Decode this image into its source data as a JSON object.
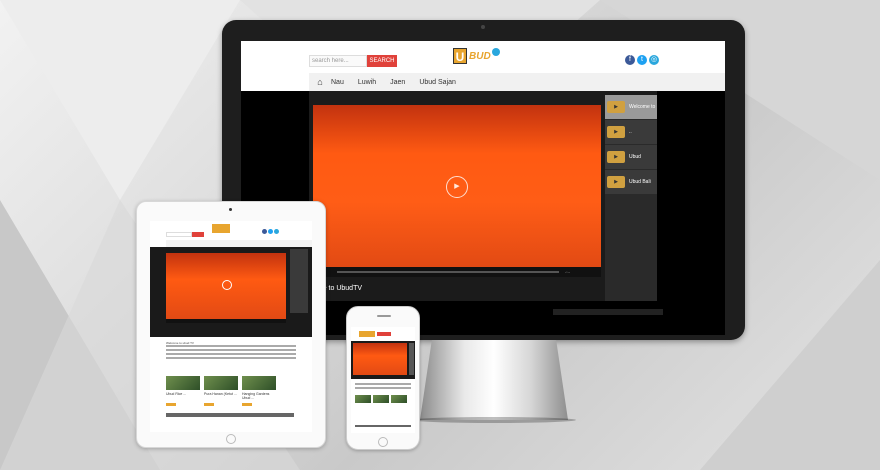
{
  "site": {
    "search_placeholder": "search here...",
    "search_button": "SEARCH",
    "logo_letter": "U",
    "logo_text": "BUD",
    "nav": [
      "Nau",
      "Luwih",
      "Jaen",
      "Ubud Sajan"
    ],
    "now_playing_caption": "ome to UbudTV",
    "playlist": [
      {
        "label": "Welcome to",
        "active": true
      },
      {
        "label": "..",
        "active": false
      },
      {
        "label": "Ubud",
        "active": false
      },
      {
        "label": "Ubud Bali",
        "active": false
      }
    ],
    "time_elapsed": "-:--",
    "time_total": "-:--"
  },
  "social_icons": [
    "facebook-icon",
    "twitter-icon",
    "instagram-icon"
  ],
  "colors": {
    "accent_red": "#e0413a",
    "logo_orange": "#e8a52f",
    "video_orange": "#ff5a12"
  },
  "ipad": {
    "intro_title": "Welcome to ubud TV",
    "cards": [
      "Ubud Rice ...",
      "Pura Hanan (Ketut ...",
      "Hanging Gardens Ubud ..."
    ]
  },
  "iphone": {
    "caption": "Welcome to UbudTV"
  }
}
